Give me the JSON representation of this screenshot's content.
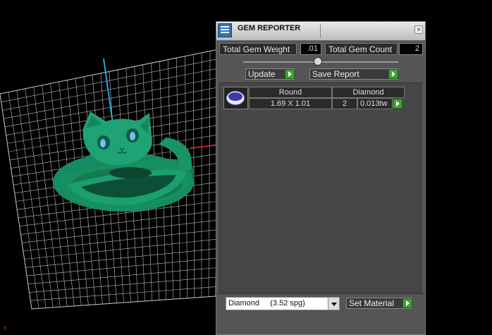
{
  "panel": {
    "title": "GEM REPORTER",
    "close_glyph": "×",
    "total_weight_label": "Total Gem Weight",
    "total_weight_value": ".01",
    "total_count_label": "Total Gem Count",
    "total_count_value": "2",
    "slider_position_pct": 48,
    "update_label": "Update",
    "save_report_label": "Save Report",
    "gem_list": {
      "rows": [
        {
          "shape": "Round",
          "material": "Diamond",
          "size": "1.69 X 1.01",
          "count": "2",
          "weight": "0.013tw"
        }
      ]
    },
    "material_select_value": "Diamond     (3.52 spg)",
    "set_material_label": "Set Material"
  },
  "viewport": {
    "object": "cat ring",
    "ring_color": "#1f9c73",
    "grid_color": "#cfcfcf",
    "axis_marker": "×"
  },
  "colors": {
    "accent_green": "#3aa62f",
    "panel_bg": "#555555"
  }
}
